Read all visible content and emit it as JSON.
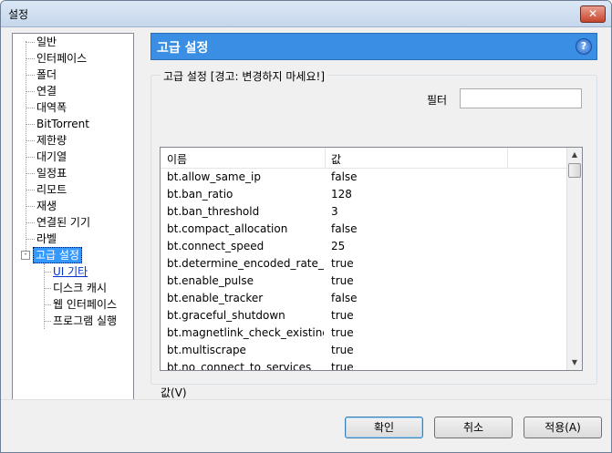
{
  "window": {
    "title": "설정",
    "close_symbol": "✕"
  },
  "tree": {
    "items": [
      {
        "label": "일반"
      },
      {
        "label": "인터페이스"
      },
      {
        "label": "폴더"
      },
      {
        "label": "연결"
      },
      {
        "label": "대역폭"
      },
      {
        "label": "BitTorrent"
      },
      {
        "label": "제한량"
      },
      {
        "label": "대기열"
      },
      {
        "label": "일정표"
      },
      {
        "label": "리모트"
      },
      {
        "label": "재생"
      },
      {
        "label": "연결된 기기"
      },
      {
        "label": "라벨"
      },
      {
        "label": "고급 설정",
        "expander": "-"
      }
    ],
    "children": [
      {
        "label": "UI 기타"
      },
      {
        "label": "디스크 캐시"
      },
      {
        "label": "웹 인터페이스"
      },
      {
        "label": "프로그램 실행"
      }
    ]
  },
  "panel": {
    "title": "고급 설정",
    "help_symbol": "?",
    "group_title": "고급 설정 [경고: 변경하지 마세요!]",
    "filter_label": "필터",
    "filter_value": "",
    "value_label": "값(V)"
  },
  "list": {
    "columns": [
      "이름",
      "값"
    ],
    "rows": [
      {
        "name": "bt.allow_same_ip",
        "value": "false"
      },
      {
        "name": "bt.ban_ratio",
        "value": "128"
      },
      {
        "name": "bt.ban_threshold",
        "value": "3"
      },
      {
        "name": "bt.compact_allocation",
        "value": "false"
      },
      {
        "name": "bt.connect_speed",
        "value": "25"
      },
      {
        "name": "bt.determine_encoded_rate_fo...",
        "value": "true"
      },
      {
        "name": "bt.enable_pulse",
        "value": "true"
      },
      {
        "name": "bt.enable_tracker",
        "value": "false"
      },
      {
        "name": "bt.graceful_shutdown",
        "value": "true"
      },
      {
        "name": "bt.magnetlink_check_existing_...",
        "value": "true"
      },
      {
        "name": "bt.multiscrape",
        "value": "true"
      },
      {
        "name": "bt.no_connect_to_services",
        "value": "true"
      }
    ],
    "scroll_up": "▲",
    "scroll_down": "▼"
  },
  "buttons": {
    "ok": "확인",
    "cancel": "취소",
    "apply": "적용(A)"
  }
}
